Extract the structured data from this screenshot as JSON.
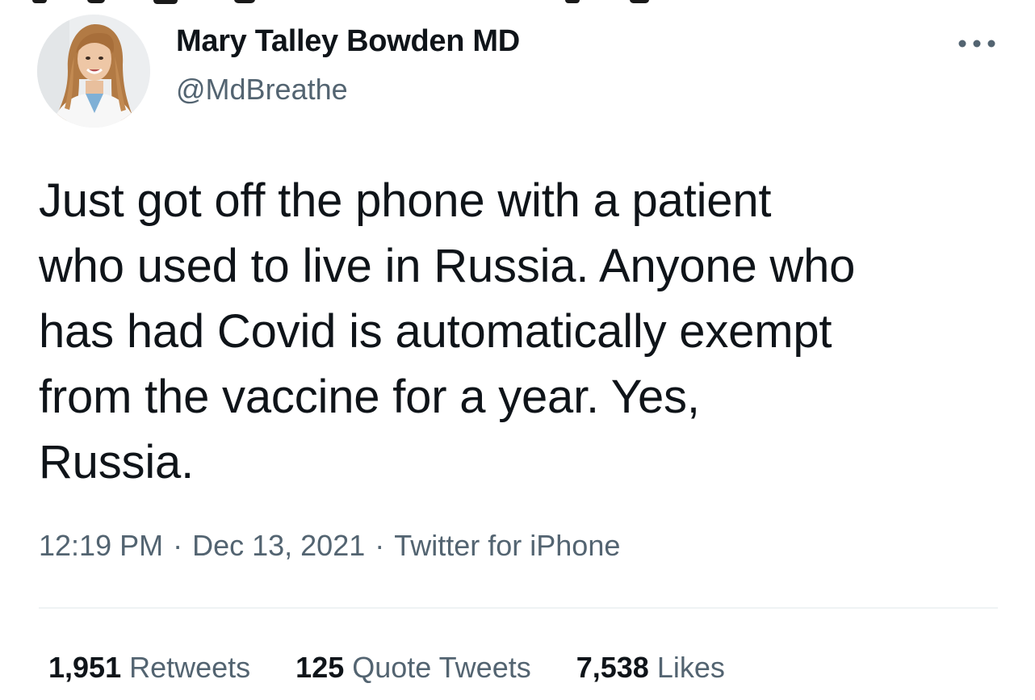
{
  "tweet": {
    "author": {
      "name": "Mary Talley Bowden MD",
      "handle": "@MdBreathe"
    },
    "text": "Just got off the phone with a patient\nwho used to live in Russia.  Anyone who\nhas had Covid is automatically exempt\nfrom the vaccine for a year.  Yes,\nRussia.",
    "time": "12:19 PM",
    "date": "Dec 13, 2021",
    "source": "Twitter for iPhone",
    "separator": "·",
    "stats": {
      "retweets": {
        "count": "1,951",
        "label": "Retweets"
      },
      "quotes": {
        "count": "125",
        "label": "Quote Tweets"
      },
      "likes": {
        "count": "7,538",
        "label": "Likes"
      }
    }
  },
  "icons": {
    "more": "more-horizontal-icon"
  },
  "colors": {
    "primary_text": "#0f1419",
    "secondary_text": "#536471",
    "divider": "#eff3f4"
  }
}
